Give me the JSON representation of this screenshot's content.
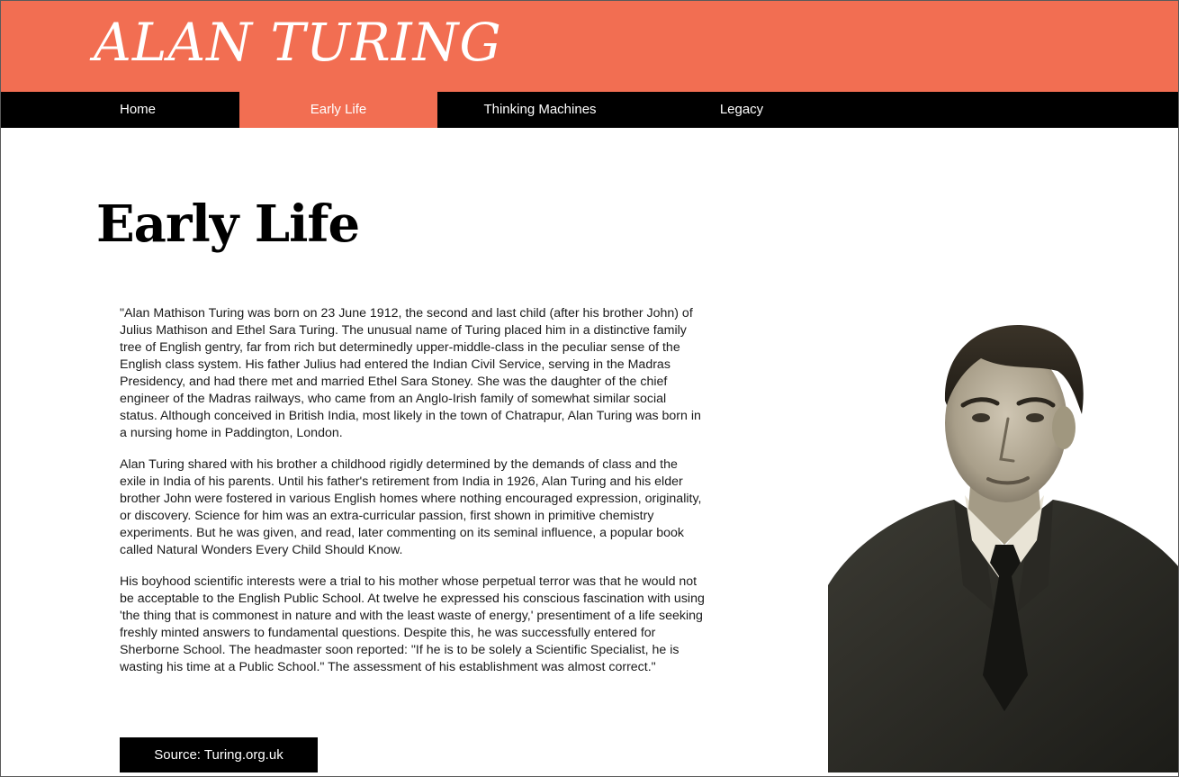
{
  "header": {
    "site_title": "ALAN TURING"
  },
  "nav": {
    "items": [
      {
        "label": "Home",
        "active": false
      },
      {
        "label": "Early Life",
        "active": true
      },
      {
        "label": "Thinking Machines",
        "active": false
      },
      {
        "label": "Legacy",
        "active": false
      }
    ]
  },
  "main": {
    "title": "Early Life",
    "paragraphs": [
      "\"Alan Mathison Turing was born on 23 June 1912, the second and last child (after his brother John) of Julius Mathison and Ethel Sara Turing. The unusual name of Turing placed him in a distinctive family tree of English gentry, far from rich but determinedly upper-middle-class in the peculiar sense of the English class system. His father Julius had entered the Indian Civil Service, serving in the Madras Presidency, and had there met and married Ethel Sara Stoney. She was the daughter of the chief engineer of the Madras railways, who came from an Anglo-Irish family of somewhat similar social status. Although conceived in British India, most likely in the town of Chatrapur, Alan Turing was born in a nursing home in Paddington, London.",
      "Alan Turing shared with his brother a childhood rigidly determined by the demands of class and the exile in India of his parents. Until his father's retirement from India in 1926, Alan Turing and his elder brother John were fostered in various English homes where nothing encouraged expression, originality, or discovery. Science for him was an extra-curricular passion, first shown in primitive chemistry experiments. But he was given, and read, later commenting on its seminal influence, a popular book called Natural Wonders Every Child Should Know.",
      "His boyhood scientific interests were a trial to his mother whose perpetual terror was that he would not be acceptable to the English Public School. At twelve he expressed his conscious fascination with using 'the thing that is commonest in nature and with the least waste of energy,' presentiment of a life seeking freshly minted answers to fundamental questions. Despite this, he was successfully entered for Sherborne School. The headmaster soon reported: \"If he is to be solely a Scientific Specialist, he is wasting his time at a Public School.\" The assessment of his establishment was almost correct.\""
    ],
    "source_button": "Source: Turing.org.uk"
  },
  "colors": {
    "accent": "#f26e52",
    "nav_background": "#000000",
    "text": "#1a1a1a"
  }
}
